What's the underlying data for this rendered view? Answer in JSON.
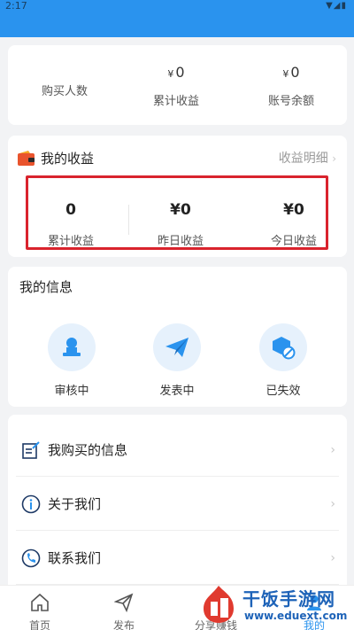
{
  "status_bar": {
    "time": "2:17",
    "icons": "wifi-icon signal-icon battery-icon"
  },
  "stats": {
    "buyers_label": "购买人数",
    "total_income_value": "0",
    "total_income_label": "累计收益",
    "balance_value": "0",
    "balance_label": "账号余额",
    "currency": "¥"
  },
  "earnings": {
    "title": "我的收益",
    "detail_link": "收益明细",
    "total_value": "0",
    "total_label": "累计收益",
    "yesterday_value": "¥0",
    "yesterday_label": "昨日收益",
    "today_value": "¥0",
    "today_label": "今日收益",
    "highlight_color": "#d9232d"
  },
  "info": {
    "title": "我的信息",
    "items": [
      {
        "label": "审核中",
        "icon": "user-stamp-icon"
      },
      {
        "label": "发表中",
        "icon": "paper-plane-icon"
      },
      {
        "label": "已失效",
        "icon": "expired-icon"
      }
    ]
  },
  "menu": {
    "items": [
      {
        "label": "我购买的信息",
        "icon": "edit-note-icon"
      },
      {
        "label": "关于我们",
        "icon": "info-icon"
      },
      {
        "label": "联系我们",
        "icon": "phone-icon"
      }
    ]
  },
  "tabbar": {
    "items": [
      {
        "label": "首页",
        "icon": "home-icon"
      },
      {
        "label": "发布",
        "icon": "send-icon"
      },
      {
        "label": "分享赚钱",
        "icon": "share-icon"
      },
      {
        "label": "我的",
        "icon": "profile-icon"
      }
    ]
  },
  "watermark": {
    "brand": "干饭手游网",
    "url": "www.eduext.com"
  },
  "colors": {
    "primary": "#2a93ee",
    "background": "#f2f3f5"
  }
}
